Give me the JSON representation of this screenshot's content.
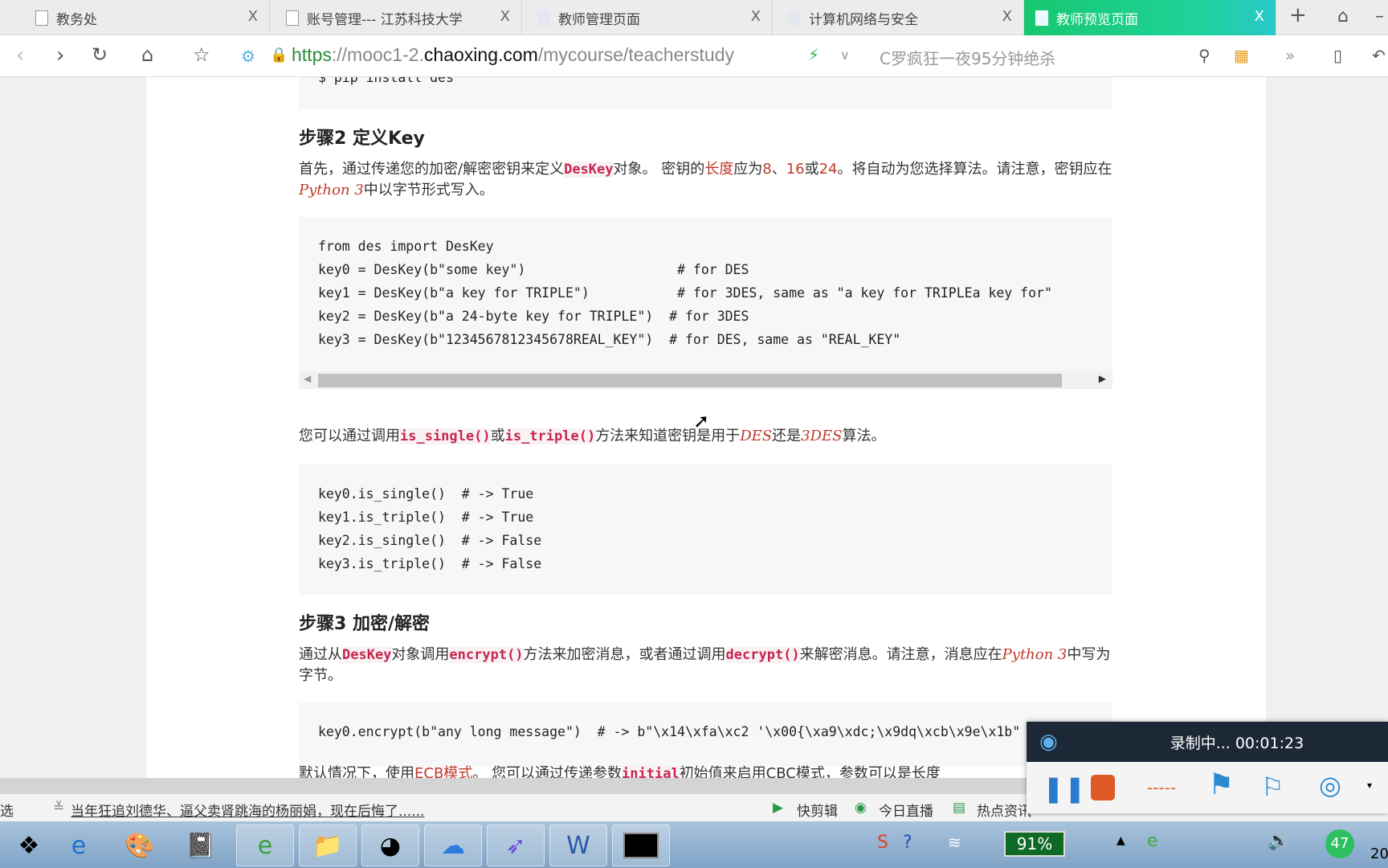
{
  "tabs": [
    {
      "label": "教务处",
      "active": false
    },
    {
      "label": "账号管理--- 江苏科技大学",
      "active": false
    },
    {
      "label": "教师管理页面",
      "active": false
    },
    {
      "label": "计算机网络与安全",
      "active": false
    },
    {
      "label": "教师预览页面",
      "active": true
    }
  ],
  "tab_close": "X",
  "address": {
    "scheme": "https",
    "rest_pre": "://mooc1-2.",
    "domain": "chaoxing.com",
    "path": "/mycourse/teacherstudy",
    "search_placeholder": "C罗疯狂一夜95分钟绝杀"
  },
  "content": {
    "pip_line": "$ pip install des",
    "step2_title": "步骤2 定义Key",
    "step2_para": [
      {
        "t": "首先，通过传递您的加密/解密密钥来定义"
      },
      {
        "t": "DesKey",
        "k": "c"
      },
      {
        "t": "对象。 密钥的"
      },
      {
        "t": "长度",
        "k": "r"
      },
      {
        "t": "应为"
      },
      {
        "t": "8",
        "k": "r"
      },
      {
        "t": "、"
      },
      {
        "t": "16",
        "k": "r"
      },
      {
        "t": "或"
      },
      {
        "t": "24",
        "k": "r"
      },
      {
        "t": "。将自动为您选择算法。请注意，密钥应在"
      },
      {
        "t": "Python 3",
        "k": "i"
      },
      {
        "t": "中以字节形式写入。"
      }
    ],
    "code1": [
      "from des import DesKey",
      "key0 = DesKey(b\"some key\")                   # for DES",
      "key1 = DesKey(b\"a key for TRIPLE\")           # for 3DES, same as \"a key for TRIPLEa key for\"",
      "key2 = DesKey(b\"a 24-byte key for TRIPLE\")  # for 3DES",
      "key3 = DesKey(b\"1234567812345678REAL_KEY\")  # for DES, same as \"REAL_KEY\""
    ],
    "para2": [
      {
        "t": "您可以通过调用"
      },
      {
        "t": "is_single()",
        "k": "c"
      },
      {
        "t": "或"
      },
      {
        "t": "is_triple()",
        "k": "c"
      },
      {
        "t": "方法来知道密钥是用于"
      },
      {
        "t": "DES",
        "k": "i"
      },
      {
        "t": "还是"
      },
      {
        "t": "3DES",
        "k": "i"
      },
      {
        "t": "算法。"
      }
    ],
    "code2": [
      "key0.is_single()  # -> True",
      "key1.is_triple()  # -> True",
      "key2.is_single()  # -> False",
      "key3.is_triple()  # -> False"
    ],
    "step3_title": "步骤3 加密/解密",
    "step3_para": [
      {
        "t": "通过从"
      },
      {
        "t": "DesKey",
        "k": "c"
      },
      {
        "t": "对象调用"
      },
      {
        "t": "encrypt()",
        "k": "c"
      },
      {
        "t": "方法来加密消息，或者通过调用"
      },
      {
        "t": "decrypt()",
        "k": "c"
      },
      {
        "t": "来解密消息。请注意，消息应在"
      },
      {
        "t": "Python 3",
        "k": "i"
      },
      {
        "t": "中写为字节。"
      }
    ],
    "code3": [
      "key0.encrypt(b\"any long message\")  # -> b\"\\x14\\xfa\\xc2 '\\x00{\\xa9\\xdc;\\x9dq\\xcb\\x9e\\x1b\""
    ],
    "para4": [
      {
        "t": "默认情况下，使用"
      },
      {
        "t": "ECB模式",
        "k": "r"
      },
      {
        "t": "。 您可以通过传递参数"
      },
      {
        "t": "initial",
        "k": "c"
      },
      {
        "t": "初始值来启用CBC模式，参数可以是长度"
      }
    ]
  },
  "status": {
    "left": "选",
    "news": "当年狂追刘德华、逼父卖肾跳海的杨丽娟，现在后悔了......",
    "items": [
      "快剪辑",
      "今日直播",
      "热点资讯"
    ]
  },
  "recorder": {
    "status": "录制中... 00:01:23"
  },
  "tray": {
    "battery": "91%",
    "badge": "47",
    "clock": "20"
  }
}
